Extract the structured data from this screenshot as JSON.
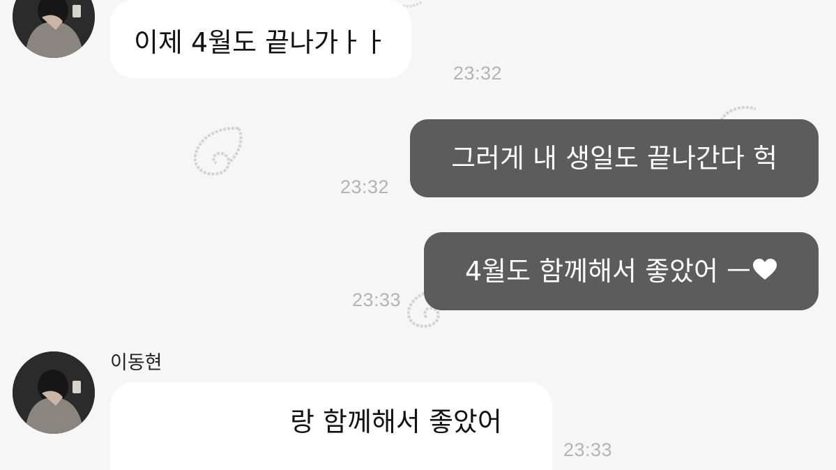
{
  "messages": [
    {
      "direction": "incoming",
      "text": "이제 4월도 끝나가ㅏㅏ",
      "time": "23:32"
    },
    {
      "direction": "outgoing",
      "text": "그러게 내 생일도 끝나간다 헉",
      "time": "23:32"
    },
    {
      "direction": "outgoing",
      "text": "4월도 함께해서 좋았어 ㅡ",
      "trailing_icon": "heart-icon",
      "time": "23:33"
    },
    {
      "direction": "incoming",
      "sender": "이동현",
      "text": "랑 함께해서 좋았어",
      "time": "23:33"
    }
  ],
  "colors": {
    "background": "#f6f6f6",
    "incoming_bubble": "#ffffff",
    "outgoing_bubble": "#5c5c5c",
    "timestamp": "#b4b4b4"
  }
}
